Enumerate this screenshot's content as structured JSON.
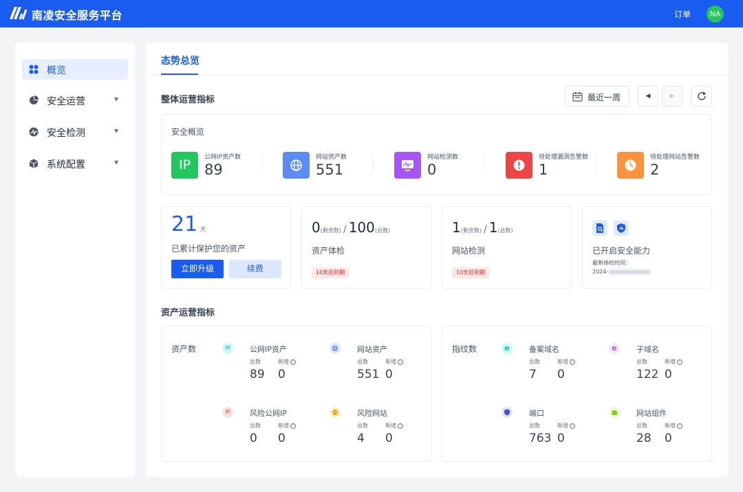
{
  "header": {
    "brand": "南凌安全服务平台",
    "orders": "订单",
    "avatar": "NA"
  },
  "sidebar": {
    "items": [
      {
        "label": "概览",
        "active": true,
        "icon": "grid-icon"
      },
      {
        "label": "安全运营",
        "icon": "pie-chart-icon",
        "caret": "▼"
      },
      {
        "label": "安全检测",
        "icon": "pulse-icon",
        "caret": "▼"
      },
      {
        "label": "系统配置",
        "icon": "cube-icon",
        "caret": "▼"
      }
    ]
  },
  "main": {
    "tab": "态势总览",
    "section_overall": "整体运营指标",
    "date_range": "最近一周",
    "overview": {
      "title": "安全概览",
      "kpis": [
        {
          "label": "公网IP资产数",
          "value": "89",
          "icon_text": "IP",
          "color": "#22c55e"
        },
        {
          "label": "网站资产数",
          "value": "551",
          "color": "#5b8cf5"
        },
        {
          "label": "网站检测数",
          "value": "0",
          "color": "#a855f7"
        },
        {
          "label": "待处理漏洞告警数",
          "value": "1",
          "color": "#ef4444"
        },
        {
          "label": "待处理网站告警数",
          "value": "2",
          "color": "#fb923c"
        }
      ]
    },
    "protect": {
      "days": "21",
      "unit": "天",
      "label": "已累计保护您的资产",
      "upgrade": "立即升级",
      "renew": "续费"
    },
    "asset_check": {
      "remaining": "0",
      "remaining_label": "(剩余数)",
      "slash": "/",
      "total": "100",
      "total_label": "(总数)",
      "label": "资产体检",
      "expire": "10天后到期"
    },
    "site_check": {
      "remaining": "1",
      "remaining_label": "(剩余数)",
      "slash": "/",
      "total": "1",
      "total_label": "(总数)",
      "label": "网站检测",
      "expire": "10天后到期"
    },
    "capability": {
      "label": "已开启安全能力",
      "last_check": "最新体检时间：",
      "date_prefix": "2024-"
    },
    "section_asset": "资产运营指标",
    "asset_counts": {
      "title": "资产数",
      "items": [
        {
          "name": "公网IP资产",
          "total": "89",
          "new": "0",
          "icon_text": "IP",
          "color": "#06b6d4"
        },
        {
          "name": "网站资产",
          "total": "551",
          "new": "0",
          "color": "#5b8cf5"
        },
        {
          "name": "风险公网IP",
          "total": "0",
          "new": "0",
          "icon_text": "IP",
          "color": "#ef4444"
        },
        {
          "name": "风险网站",
          "total": "4",
          "new": "0",
          "color": "#f59e0b"
        }
      ]
    },
    "fingerprint": {
      "title": "指纹数",
      "items": [
        {
          "name": "备案域名",
          "total": "7",
          "new": "0",
          "icon_text": "e",
          "color": "#14b8a6"
        },
        {
          "name": "子域名",
          "total": "122",
          "new": "0",
          "icon_text": "e",
          "color": "#a855f7"
        },
        {
          "name": "端口",
          "total": "763",
          "new": "0",
          "color": "#4f46e5"
        },
        {
          "name": "网站组件",
          "total": "28",
          "new": "0",
          "color": "#84cc16"
        }
      ]
    },
    "labels": {
      "total": "总数",
      "new": "新增"
    }
  }
}
